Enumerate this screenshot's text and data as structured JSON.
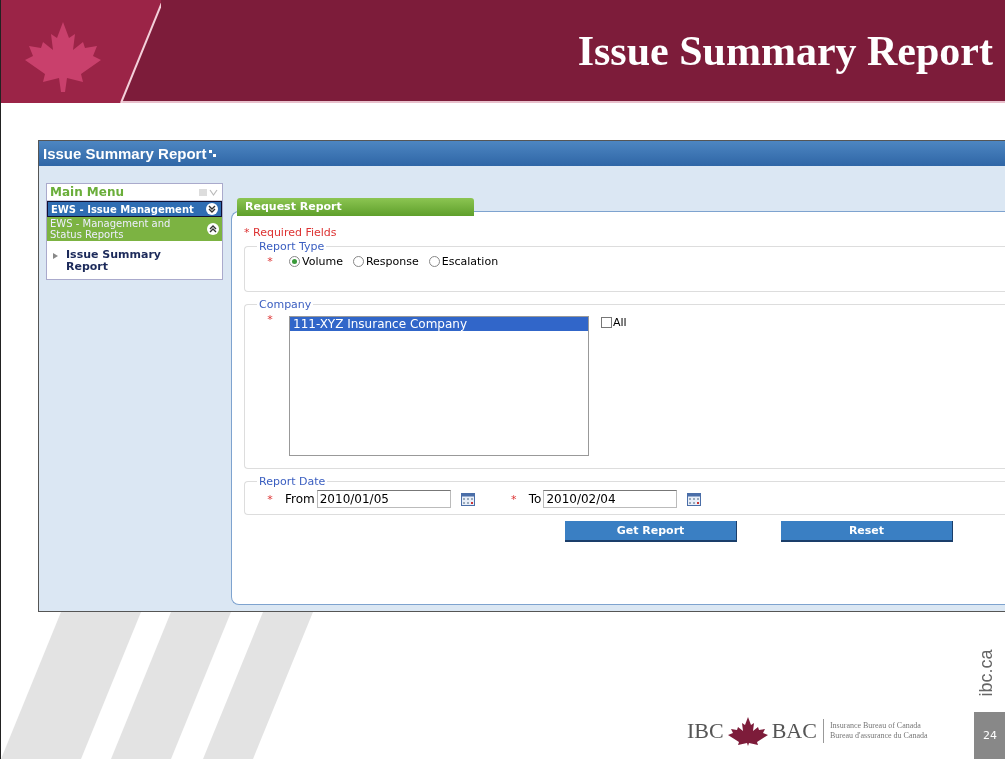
{
  "slide": {
    "title": "Issue Summary Report",
    "site": "ibc.ca",
    "page_number": "24"
  },
  "logo": {
    "left": "IBC",
    "right": "BAC",
    "line_1": "Insurance Bureau of Canada",
    "line_2": "Bureau d'assurance du Canada"
  },
  "app": {
    "title": "Issue Summary Report",
    "sidebar": {
      "heading": "Main Menu",
      "groups": [
        {
          "label": "EWS - Issue Management",
          "expanded": false
        },
        {
          "label": "EWS - Management and Status Reports",
          "expanded": true,
          "children": [
            {
              "label": "Issue Summary Report"
            }
          ]
        }
      ]
    },
    "form": {
      "panel_title": "Request Report",
      "required_note": "* Required Fields",
      "report_type": {
        "legend": "Report Type",
        "required_mark": "*",
        "options": [
          {
            "label": "Volume",
            "selected": true
          },
          {
            "label": "Response",
            "selected": false
          },
          {
            "label": "Escalation",
            "selected": false
          }
        ]
      },
      "company": {
        "legend": "Company",
        "required_mark": "*",
        "items": [
          {
            "label": "111-XYZ Insurance Company",
            "selected": true
          }
        ],
        "all_checkbox": {
          "label": "All",
          "checked": false
        }
      },
      "report_date": {
        "legend": "Report Date",
        "from": {
          "required_mark": "*",
          "label": "From",
          "value": "2010/01/05"
        },
        "to": {
          "required_mark": "*",
          "label": "To",
          "value": "2010/02/04"
        }
      },
      "buttons": [
        "Get Report",
        "Reset"
      ]
    }
  }
}
